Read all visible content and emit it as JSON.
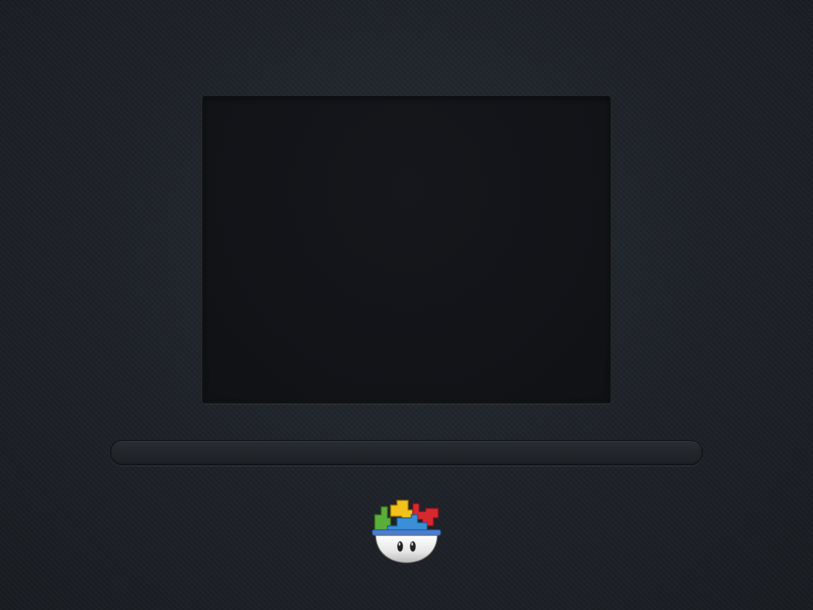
{
  "app": {
    "logo_icon": "gcompris-bowl-logo-icon"
  },
  "loader": {
    "progress": 0,
    "track_color": "#22262b",
    "stage_color": "#111317"
  },
  "logo_colors": {
    "green": "#5cae3a",
    "yellow": "#f2c21b",
    "red": "#d8282f",
    "blue": "#3a8fd6",
    "bowl_rim": "#4a7fd0",
    "bowl": "#f0f0f0"
  }
}
